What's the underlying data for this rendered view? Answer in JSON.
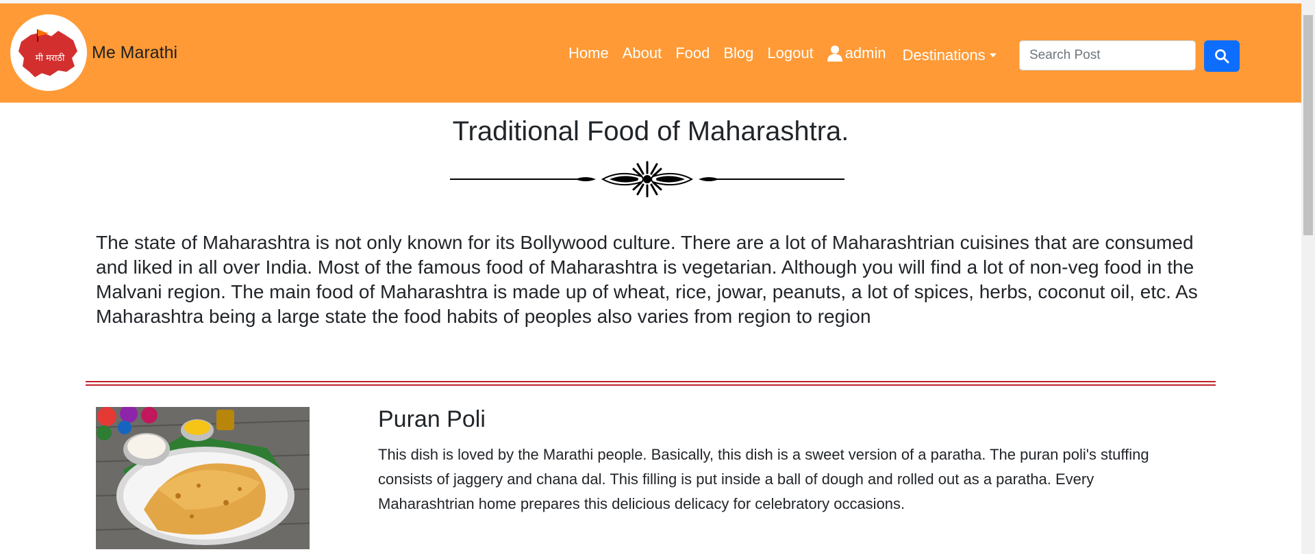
{
  "brand": {
    "name": "Me Marathi",
    "logo_text": "मी मराठी",
    "logo_icon": "maharashtra-map-logo"
  },
  "nav": {
    "links": [
      "Home",
      "About",
      "Food",
      "Blog",
      "Logout"
    ],
    "user_label": "admin",
    "user_icon": "user-icon",
    "dropdown_label": "Destinations"
  },
  "search": {
    "placeholder": "Search Post",
    "value": "",
    "button_icon": "search-icon"
  },
  "colors": {
    "navbar": "#ff9a36",
    "search_button": "#0d6efd",
    "rule": "#c0202b"
  },
  "content": {
    "title": "Traditional Food of Maharashtra.",
    "intro": "The state of Maharashtra is not only known for its Bollywood culture. There are a lot of Maharashtrian cuisines that are consumed and liked in all over India. Most of the famous food of Maharashtra is vegetarian. Although you will find a lot of non-veg food in the Malvani region. The main food of Maharashtra is made up of wheat, rice, jowar, peanuts, a lot of spices, herbs, coconut oil, etc. As Maharashtra being a large state the food habits of peoples also varies from region to region",
    "items": [
      {
        "title": "Puran Poli",
        "description": "This dish is loved by the Marathi people. Basically, this dish is a sweet version of a paratha. The puran poli's stuffing consists of jaggery and chana dal. This filling is put inside a ball of dough and rolled out as a paratha. Every Maharashtrian home prepares this delicious delicacy for celebratory occasions."
      }
    ]
  }
}
